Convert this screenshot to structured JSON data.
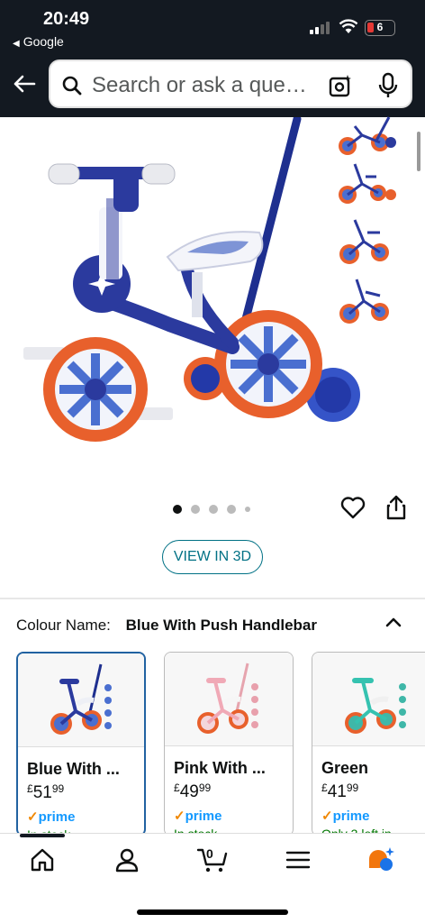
{
  "status_bar": {
    "time": "20:49",
    "back_app": "Google",
    "battery": "6"
  },
  "search": {
    "placeholder": "Search or ask a que…"
  },
  "icons": {
    "back": "arrow-left-icon",
    "search": "search-icon",
    "camera": "camera-lens-icon",
    "mic": "microphone-icon",
    "heart": "heart-icon",
    "share": "share-icon",
    "home": "home-icon",
    "account": "user-icon",
    "cart": "cart-icon",
    "menu": "menu-icon",
    "rufus": "rufus-assistant-icon"
  },
  "gallery": {
    "image_count": 5,
    "active_index": 0,
    "view_3d_label": "VIEW IN 3D"
  },
  "variation": {
    "label": "Colour Name:",
    "selected_value": "Blue With Push Handlebar",
    "options": [
      {
        "name": "Blue With ...",
        "currency": "£",
        "price_whole": "51",
        "price_fraction": "99",
        "prime": "prime",
        "stock": "In stock",
        "selected": true
      },
      {
        "name": "Pink With ...",
        "currency": "£",
        "price_whole": "49",
        "price_fraction": "99",
        "prime": "prime",
        "stock": "In stock",
        "selected": false
      },
      {
        "name": "Green",
        "currency": "£",
        "price_whole": "41",
        "price_fraction": "99",
        "prime": "prime",
        "stock": "Only 3 left in",
        "selected": false
      }
    ]
  },
  "cart": {
    "count": "0"
  },
  "colors": {
    "header_bg": "#131921",
    "link_teal": "#007185",
    "selected_border": "#2162a1",
    "prime_blue": "#1399ff",
    "bike_blue": "#2b3a9e",
    "bike_orange": "#e8602c"
  }
}
